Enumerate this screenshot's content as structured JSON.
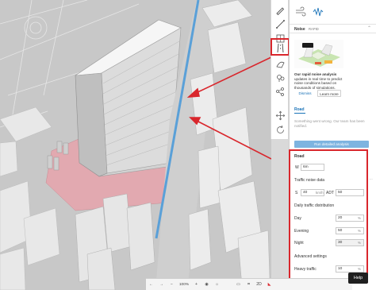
{
  "colors": {
    "accent": "#1a73b8",
    "annotation_red": "#d9262c",
    "road_highlight": "#5aa0d8",
    "site_fill": "#e2a9b0",
    "run_button": "#7eb4e0"
  },
  "toolstrip": {
    "icons": [
      "pencil-icon",
      "diagonal-line-icon",
      "grid-icon",
      "road-tool-icon",
      "zone-icon",
      "trees-icon",
      "nodes-icon",
      "move-icon",
      "rotate-icon"
    ]
  },
  "panel": {
    "header_icons": [
      "wind-icon",
      "noise-wave-icon"
    ],
    "noise_title": "Noise",
    "noise_badge": "RAPID",
    "promo_text_bold": "Our rapid noise analysis",
    "promo_text": "updates in real time to predict noise conditions based on thousands of simulations.",
    "dismiss_label": "Dismiss",
    "learn_more_label": "Learn more",
    "tab_road": "Road",
    "error_text": "Something went wrong. Our team has been notified.",
    "run_button_label": "Run detailed analysis"
  },
  "road_form": {
    "section_title": "Road",
    "width_label": "W",
    "width_value": "6m",
    "traffic_title": "Traffic noise data",
    "speed_label": "S",
    "speed_value": "40",
    "speed_unit": "km/h",
    "adt_label": "ADT",
    "adt_value": "50",
    "daily_title": "Daily traffic distribution",
    "day_label": "Day",
    "day_value": "20",
    "evening_label": "Evening",
    "evening_value": "50",
    "night_label": "Night",
    "night_value": "30",
    "percent_symbol": "%",
    "advanced_title": "Advanced settings",
    "heavy_label": "Heavy traffic",
    "heavy_value": "10"
  },
  "bottombar": {
    "zoom_text": "100%",
    "icons": [
      "arrow-left-icon",
      "arrow-right-icon",
      "zoom-out-icon",
      "zoom-in-icon",
      "camera-icon",
      "sun-icon",
      "layers-icon",
      "view-2d-icon",
      "measure-icon"
    ],
    "view_2d_label": "2D"
  },
  "help_label": "Help"
}
